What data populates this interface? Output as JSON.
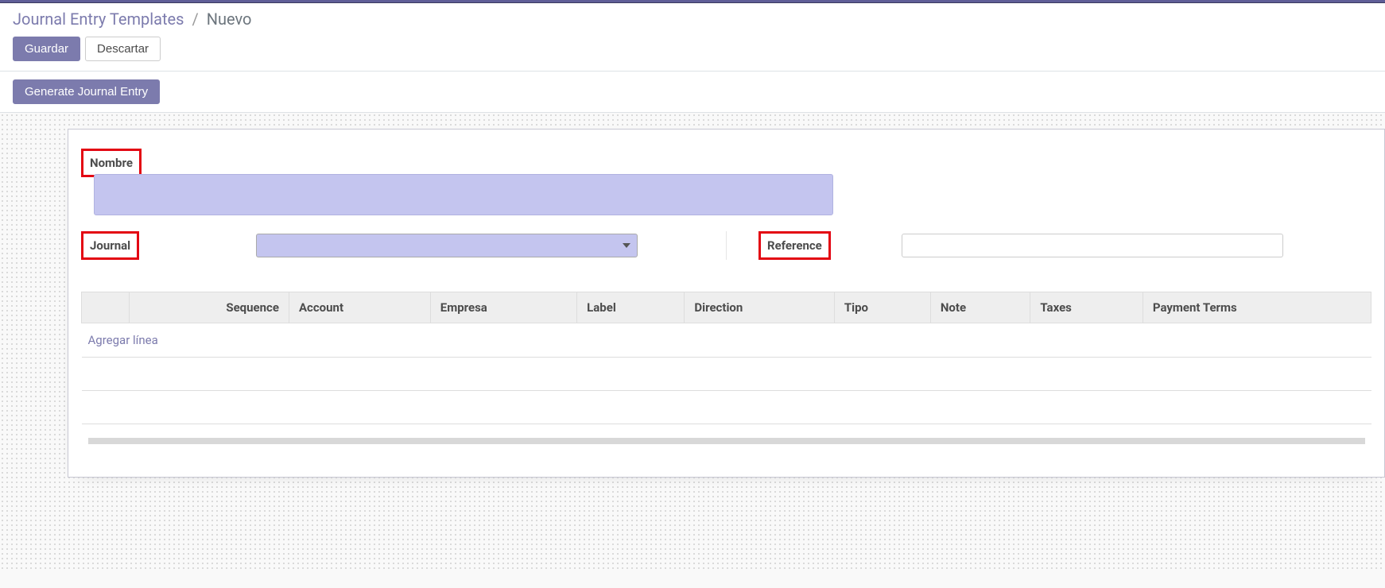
{
  "breadcrumb": {
    "parent": "Journal Entry Templates",
    "separator": "/",
    "current": "Nuevo"
  },
  "buttons": {
    "save": "Guardar",
    "discard": "Descartar",
    "generate": "Generate Journal Entry"
  },
  "form": {
    "nombre_label": "Nombre",
    "nombre_value": "",
    "journal_label": "Journal",
    "journal_value": "",
    "reference_label": "Reference",
    "reference_value": ""
  },
  "table": {
    "columns": [
      "",
      "Sequence",
      "Account",
      "Empresa",
      "Label",
      "Direction",
      "Tipo",
      "Note",
      "Taxes",
      "Payment Terms"
    ],
    "add_line": "Agregar línea"
  }
}
